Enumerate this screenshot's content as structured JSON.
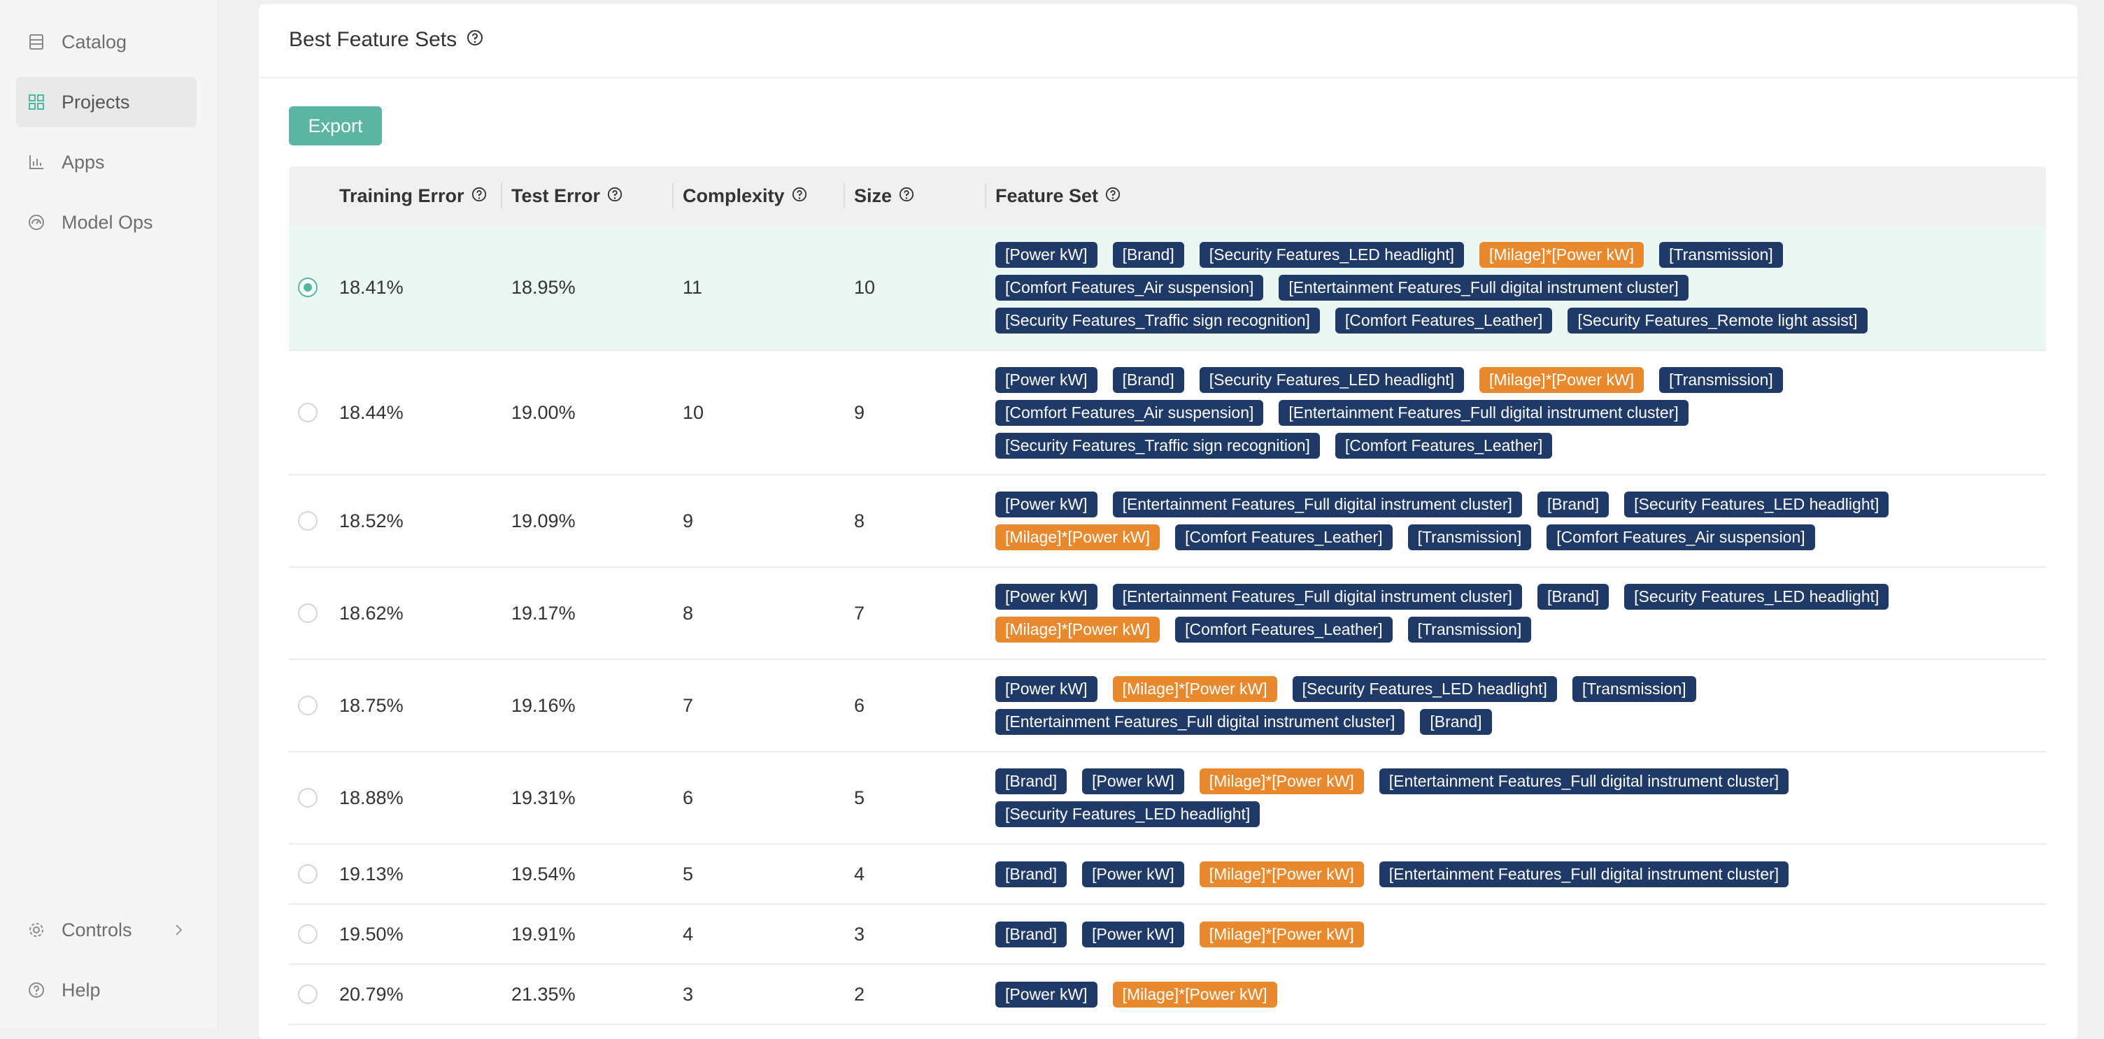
{
  "sidebar": {
    "items": [
      {
        "label": "Catalog",
        "icon": "catalog-icon"
      },
      {
        "label": "Projects",
        "icon": "projects-icon"
      },
      {
        "label": "Apps",
        "icon": "apps-icon"
      },
      {
        "label": "Model Ops",
        "icon": "model-ops-icon"
      }
    ],
    "bottom": [
      {
        "label": "Controls",
        "icon": "gear-icon"
      },
      {
        "label": "Help",
        "icon": "help-icon"
      }
    ]
  },
  "card": {
    "title": "Best Feature Sets",
    "export_label": "Export"
  },
  "table": {
    "columns": [
      "Training Error",
      "Test Error",
      "Complexity",
      "Size",
      "Feature Set"
    ],
    "rows": [
      {
        "selected": true,
        "training_error": "18.41%",
        "test_error": "18.95%",
        "complexity": "11",
        "size": "10",
        "features": [
          {
            "label": "[Power kW]",
            "kind": "base"
          },
          {
            "label": "[Brand]",
            "kind": "base"
          },
          {
            "label": "[Security Features_LED headlight]",
            "kind": "base"
          },
          {
            "label": "[Milage]*[Power kW]",
            "kind": "interaction"
          },
          {
            "label": "[Transmission]",
            "kind": "base"
          },
          {
            "label": "[Comfort Features_Air suspension]",
            "kind": "base"
          },
          {
            "label": "[Entertainment Features_Full digital instrument cluster]",
            "kind": "base"
          },
          {
            "label": "[Security Features_Traffic sign recognition]",
            "kind": "base"
          },
          {
            "label": "[Comfort Features_Leather]",
            "kind": "base"
          },
          {
            "label": "[Security Features_Remote light assist]",
            "kind": "base"
          }
        ]
      },
      {
        "selected": false,
        "training_error": "18.44%",
        "test_error": "19.00%",
        "complexity": "10",
        "size": "9",
        "features": [
          {
            "label": "[Power kW]",
            "kind": "base"
          },
          {
            "label": "[Brand]",
            "kind": "base"
          },
          {
            "label": "[Security Features_LED headlight]",
            "kind": "base"
          },
          {
            "label": "[Milage]*[Power kW]",
            "kind": "interaction"
          },
          {
            "label": "[Transmission]",
            "kind": "base"
          },
          {
            "label": "[Comfort Features_Air suspension]",
            "kind": "base"
          },
          {
            "label": "[Entertainment Features_Full digital instrument cluster]",
            "kind": "base"
          },
          {
            "label": "[Security Features_Traffic sign recognition]",
            "kind": "base"
          },
          {
            "label": "[Comfort Features_Leather]",
            "kind": "base"
          }
        ]
      },
      {
        "selected": false,
        "training_error": "18.52%",
        "test_error": "19.09%",
        "complexity": "9",
        "size": "8",
        "features": [
          {
            "label": "[Power kW]",
            "kind": "base"
          },
          {
            "label": "[Entertainment Features_Full digital instrument cluster]",
            "kind": "base"
          },
          {
            "label": "[Brand]",
            "kind": "base"
          },
          {
            "label": "[Security Features_LED headlight]",
            "kind": "base"
          },
          {
            "label": "[Milage]*[Power kW]",
            "kind": "interaction"
          },
          {
            "label": "[Comfort Features_Leather]",
            "kind": "base"
          },
          {
            "label": "[Transmission]",
            "kind": "base"
          },
          {
            "label": "[Comfort Features_Air suspension]",
            "kind": "base"
          }
        ]
      },
      {
        "selected": false,
        "training_error": "18.62%",
        "test_error": "19.17%",
        "complexity": "8",
        "size": "7",
        "features": [
          {
            "label": "[Power kW]",
            "kind": "base"
          },
          {
            "label": "[Entertainment Features_Full digital instrument cluster]",
            "kind": "base"
          },
          {
            "label": "[Brand]",
            "kind": "base"
          },
          {
            "label": "[Security Features_LED headlight]",
            "kind": "base"
          },
          {
            "label": "[Milage]*[Power kW]",
            "kind": "interaction"
          },
          {
            "label": "[Comfort Features_Leather]",
            "kind": "base"
          },
          {
            "label": "[Transmission]",
            "kind": "base"
          }
        ]
      },
      {
        "selected": false,
        "training_error": "18.75%",
        "test_error": "19.16%",
        "complexity": "7",
        "size": "6",
        "features": [
          {
            "label": "[Power kW]",
            "kind": "base"
          },
          {
            "label": "[Milage]*[Power kW]",
            "kind": "interaction"
          },
          {
            "label": "[Security Features_LED headlight]",
            "kind": "base"
          },
          {
            "label": "[Transmission]",
            "kind": "base"
          },
          {
            "label": "[Entertainment Features_Full digital instrument cluster]",
            "kind": "base"
          },
          {
            "label": "[Brand]",
            "kind": "base"
          }
        ]
      },
      {
        "selected": false,
        "training_error": "18.88%",
        "test_error": "19.31%",
        "complexity": "6",
        "size": "5",
        "features": [
          {
            "label": "[Brand]",
            "kind": "base"
          },
          {
            "label": "[Power kW]",
            "kind": "base"
          },
          {
            "label": "[Milage]*[Power kW]",
            "kind": "interaction"
          },
          {
            "label": "[Entertainment Features_Full digital instrument cluster]",
            "kind": "base"
          },
          {
            "label": "[Security Features_LED headlight]",
            "kind": "base"
          }
        ]
      },
      {
        "selected": false,
        "training_error": "19.13%",
        "test_error": "19.54%",
        "complexity": "5",
        "size": "4",
        "features": [
          {
            "label": "[Brand]",
            "kind": "base"
          },
          {
            "label": "[Power kW]",
            "kind": "base"
          },
          {
            "label": "[Milage]*[Power kW]",
            "kind": "interaction"
          },
          {
            "label": "[Entertainment Features_Full digital instrument cluster]",
            "kind": "base"
          }
        ]
      },
      {
        "selected": false,
        "training_error": "19.50%",
        "test_error": "19.91%",
        "complexity": "4",
        "size": "3",
        "features": [
          {
            "label": "[Brand]",
            "kind": "base"
          },
          {
            "label": "[Power kW]",
            "kind": "base"
          },
          {
            "label": "[Milage]*[Power kW]",
            "kind": "interaction"
          }
        ]
      },
      {
        "selected": false,
        "training_error": "20.79%",
        "test_error": "21.35%",
        "complexity": "3",
        "size": "2",
        "features": [
          {
            "label": "[Power kW]",
            "kind": "base"
          },
          {
            "label": "[Milage]*[Power kW]",
            "kind": "interaction"
          }
        ]
      }
    ]
  },
  "colors": {
    "accent": "#5bb5a2",
    "selected_row": "#eaf7f3",
    "tag_base": "#1f3a66",
    "tag_interaction": "#e8892e"
  }
}
